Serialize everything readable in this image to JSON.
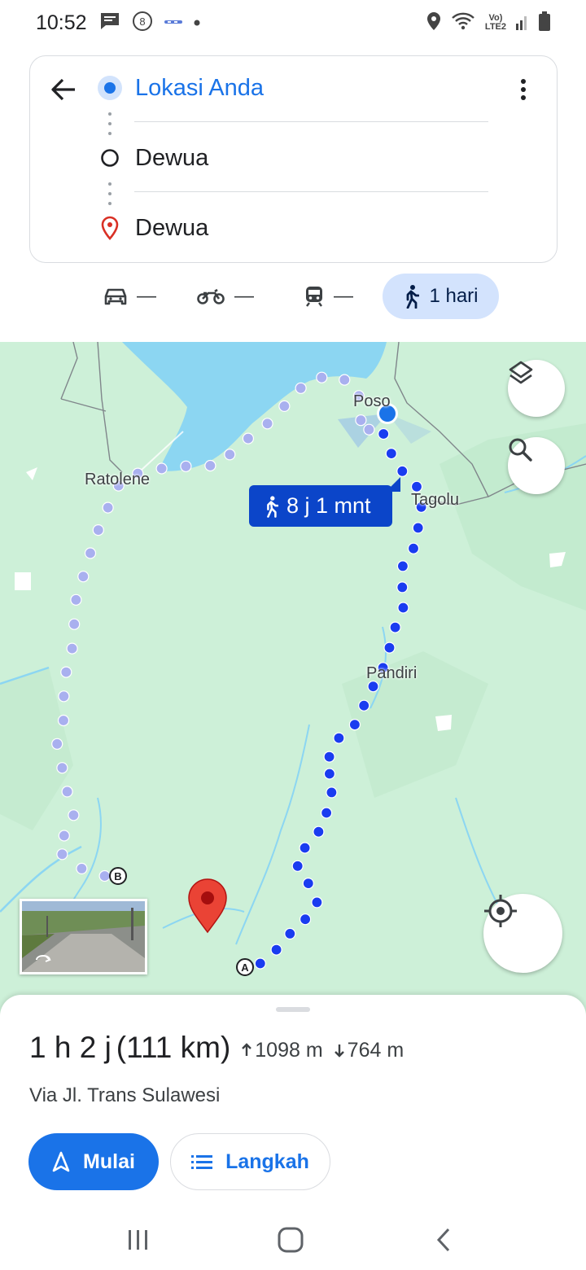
{
  "status_bar": {
    "time": "10:52",
    "network": "LTE2"
  },
  "directions": {
    "origin": "Lokasi Anda",
    "stop": "Dewua",
    "destination": "Dewua"
  },
  "modes": {
    "car": "—",
    "motorcycle": "—",
    "transit": "—",
    "walk": "1 hari"
  },
  "map": {
    "labels": {
      "poso": "Poso",
      "tagolu": "Tagolu",
      "ratolene": "Ratolene",
      "pandiri": "Pandiri"
    },
    "marker_a": "A",
    "marker_b": "B",
    "duration_chip": "8 j 1 mnt"
  },
  "summary": {
    "duration": "1 h 2 j",
    "distance": "(111 km)",
    "ascent": "1098 m",
    "descent": "764 m",
    "via": "Via Jl. Trans Sulawesi"
  },
  "actions": {
    "start": "Mulai",
    "steps": "Langkah"
  },
  "colors": {
    "accent": "#1a73e8",
    "route_primary": "#1a3cf0",
    "route_alt": "#a9b0ef",
    "water": "#8cd6f2",
    "land": "#cdf0d8"
  }
}
